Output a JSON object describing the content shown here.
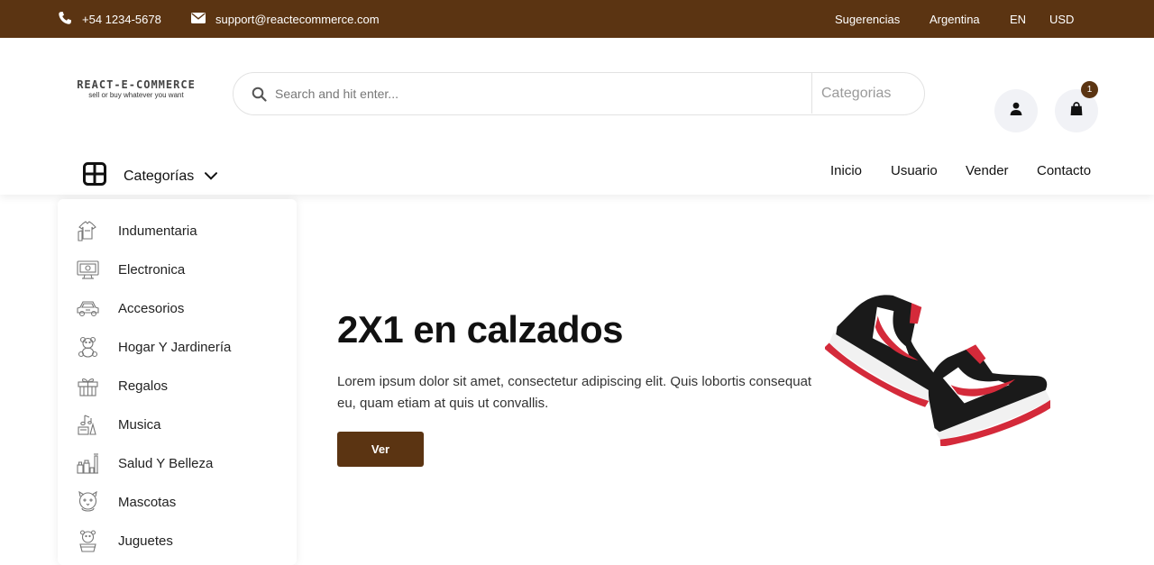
{
  "topbar": {
    "phone": "+54 1234-5678",
    "email": "support@reactecommerce.com",
    "links": [
      "Sugerencias",
      "Argentina",
      "EN",
      "USD"
    ]
  },
  "logo": {
    "title": "REACT-E-COMMERCE",
    "tagline": "sell or buy whatever you want"
  },
  "search": {
    "placeholder": "Search and hit enter...",
    "value": "",
    "category": "Categorias"
  },
  "cart": {
    "count": "1"
  },
  "categories_menu": {
    "label": "Categorías"
  },
  "nav": [
    "Inicio",
    "Usuario",
    "Vender",
    "Contacto"
  ],
  "sidebar": {
    "items": [
      {
        "label": "Indumentaria",
        "icon": "clothing-icon"
      },
      {
        "label": "Electronica",
        "icon": "monitor-icon"
      },
      {
        "label": "Accesorios",
        "icon": "car-icon"
      },
      {
        "label": "Hogar Y Jardinería",
        "icon": "teddy-bear-icon"
      },
      {
        "label": "Regalos",
        "icon": "gift-icon"
      },
      {
        "label": "Musica",
        "icon": "music-icon"
      },
      {
        "label": "Salud Y Belleza",
        "icon": "beauty-icon"
      },
      {
        "label": "Mascotas",
        "icon": "pet-icon"
      },
      {
        "label": "Juguetes",
        "icon": "toy-icon"
      }
    ]
  },
  "hero": {
    "title": "2X1 en calzados",
    "text": "Lorem ipsum dolor sit amet, consectetur adipiscing elit. Quis lobortis consequat eu, quam etiam at quis ut convallis.",
    "button": "Ver"
  },
  "colors": {
    "brand": "#5b3412",
    "shoe_red": "#d42a3a",
    "shoe_black": "#1a1a1a"
  }
}
